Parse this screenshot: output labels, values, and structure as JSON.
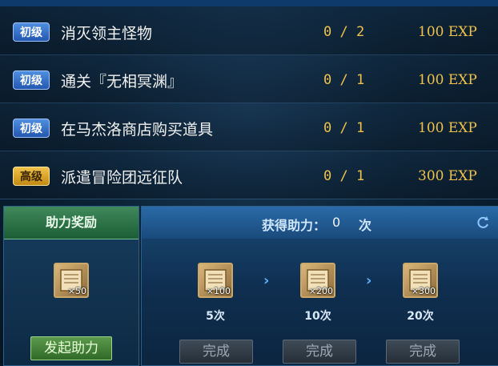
{
  "tasks": [
    {
      "level": "初级",
      "level_color": "blue",
      "name": "消灭领主怪物",
      "progress": "0 / 2",
      "reward": "100 EXP"
    },
    {
      "level": "初级",
      "level_color": "blue",
      "name": "通关『无相冥渊』",
      "progress": "0 / 1",
      "reward": "100 EXP"
    },
    {
      "level": "初级",
      "level_color": "blue",
      "name": "在马杰洛商店购买道具",
      "progress": "0 / 1",
      "reward": "100 EXP"
    },
    {
      "level": "高级",
      "level_color": "gold",
      "name": "派遣冒险团远征队",
      "progress": "0 / 1",
      "reward": "300 EXP"
    }
  ],
  "assist_panel": {
    "title": "助力奖励",
    "reward_qty": "×50",
    "button_label": "发起助力"
  },
  "progress_panel": {
    "label": "获得助力：",
    "count": "0",
    "unit": "次",
    "milestones": [
      {
        "qty": "×100",
        "label": "5次",
        "button": "完成"
      },
      {
        "qty": "×200",
        "label": "10次",
        "button": "完成"
      },
      {
        "qty": "×300",
        "label": "20次",
        "button": "完成"
      }
    ]
  },
  "icons": {
    "reward": "book-icon",
    "arrow": "chevron-right-icon",
    "refresh": "refresh-icon"
  }
}
